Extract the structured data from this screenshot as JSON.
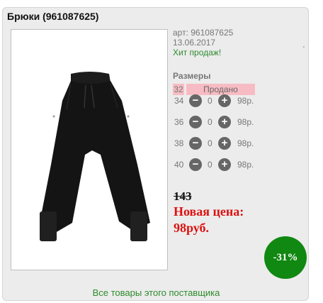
{
  "product": {
    "title": "Брюки (961087625)",
    "art": "арт: 961087625",
    "date": "13.06.2017",
    "hit": "Хит продаж!",
    "tick": "'"
  },
  "sizes": {
    "title": "Размеры",
    "sold_size": "32",
    "sold_label": "Продано",
    "rows": [
      {
        "size": "34",
        "qty": "0",
        "price": "98р."
      },
      {
        "size": "36",
        "qty": "0",
        "price": "98р."
      },
      {
        "size": "38",
        "qty": "0",
        "price": "98р."
      },
      {
        "size": "40",
        "qty": "0",
        "price": "98р."
      }
    ],
    "minus_glyph": "−",
    "plus_glyph": "+"
  },
  "pricing": {
    "old_price": "143",
    "new_price_label": "Новая цена:",
    "new_price": "98руб.",
    "discount_badge": "-31%"
  },
  "footer": {
    "supplier_link": "Все товары этого поставщика"
  },
  "colors": {
    "accent_green": "#2e8b2e",
    "badge_green": "#118811",
    "price_red": "#dd1111",
    "sold_pink": "#f7bcc3"
  },
  "icons": {
    "minus": "minus-circle-icon",
    "plus": "plus-circle-icon"
  }
}
